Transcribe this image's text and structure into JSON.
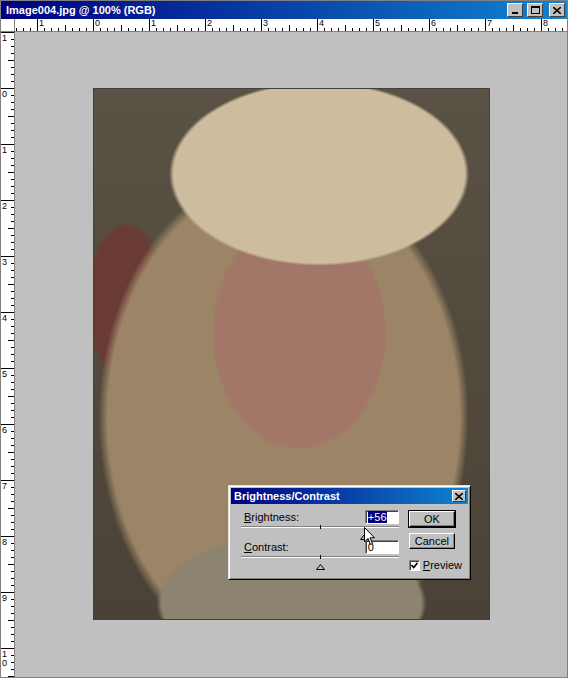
{
  "window": {
    "title": "Image004.jpg @ 100% (RGB)"
  },
  "rulers": {
    "horizontal": [
      "1",
      "0",
      "1",
      "2",
      "3",
      "4",
      "5",
      "6",
      "7",
      "8"
    ],
    "vertical": [
      "1",
      "0",
      "1",
      "2",
      "3",
      "4",
      "5",
      "6",
      "7",
      "8",
      "9",
      "10"
    ]
  },
  "dialog": {
    "title": "Brightness/Contrast",
    "sliders": [
      {
        "label": "Brightness:",
        "value": "+56",
        "level": 0.78,
        "focused": true
      },
      {
        "label": "Contrast:",
        "value": "0",
        "level": 0.5,
        "focused": false
      }
    ],
    "buttons": [
      {
        "label": "OK",
        "default": true
      },
      {
        "label": "Cancel",
        "default": false
      }
    ],
    "preview": {
      "label": "Preview",
      "checked": true
    }
  }
}
